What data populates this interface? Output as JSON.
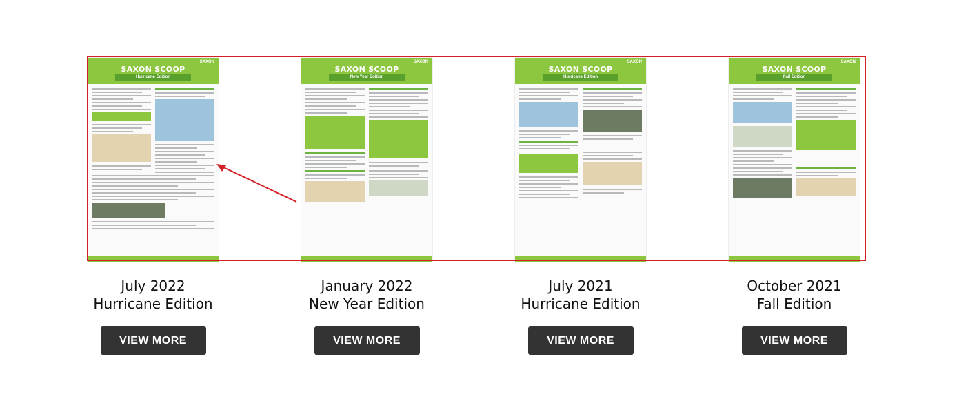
{
  "newsletters": [
    {
      "masthead": "SAXON SCOOP",
      "edition_banner": "Hurricane Edition",
      "brand": "SAXON",
      "date_line": "July 2022",
      "edition_line": "Hurricane Edition",
      "button_label": "VIEW MORE"
    },
    {
      "masthead": "SAXON SCOOP",
      "edition_banner": "New Year Edition",
      "brand": "SAXON",
      "date_line": "January 2022",
      "edition_line": "New Year Edition",
      "button_label": "VIEW MORE"
    },
    {
      "masthead": "SAXON SCOOP",
      "edition_banner": "Hurricane Edition",
      "brand": "SAXON",
      "date_line": "July 2021",
      "edition_line": "Hurricane Edition",
      "button_label": "VIEW MORE"
    },
    {
      "masthead": "SAXON SCOOP",
      "edition_banner": "Fall Edition",
      "brand": "SAXON",
      "date_line": "October 2021",
      "edition_line": "Fall Edition",
      "button_label": "VIEW MORE"
    }
  ],
  "colors": {
    "highlight_border": "#d32027",
    "annotation_arrow": "#d32027",
    "brand_green": "#8dc63f",
    "button_bg": "#333333",
    "button_text": "#ffffff"
  }
}
